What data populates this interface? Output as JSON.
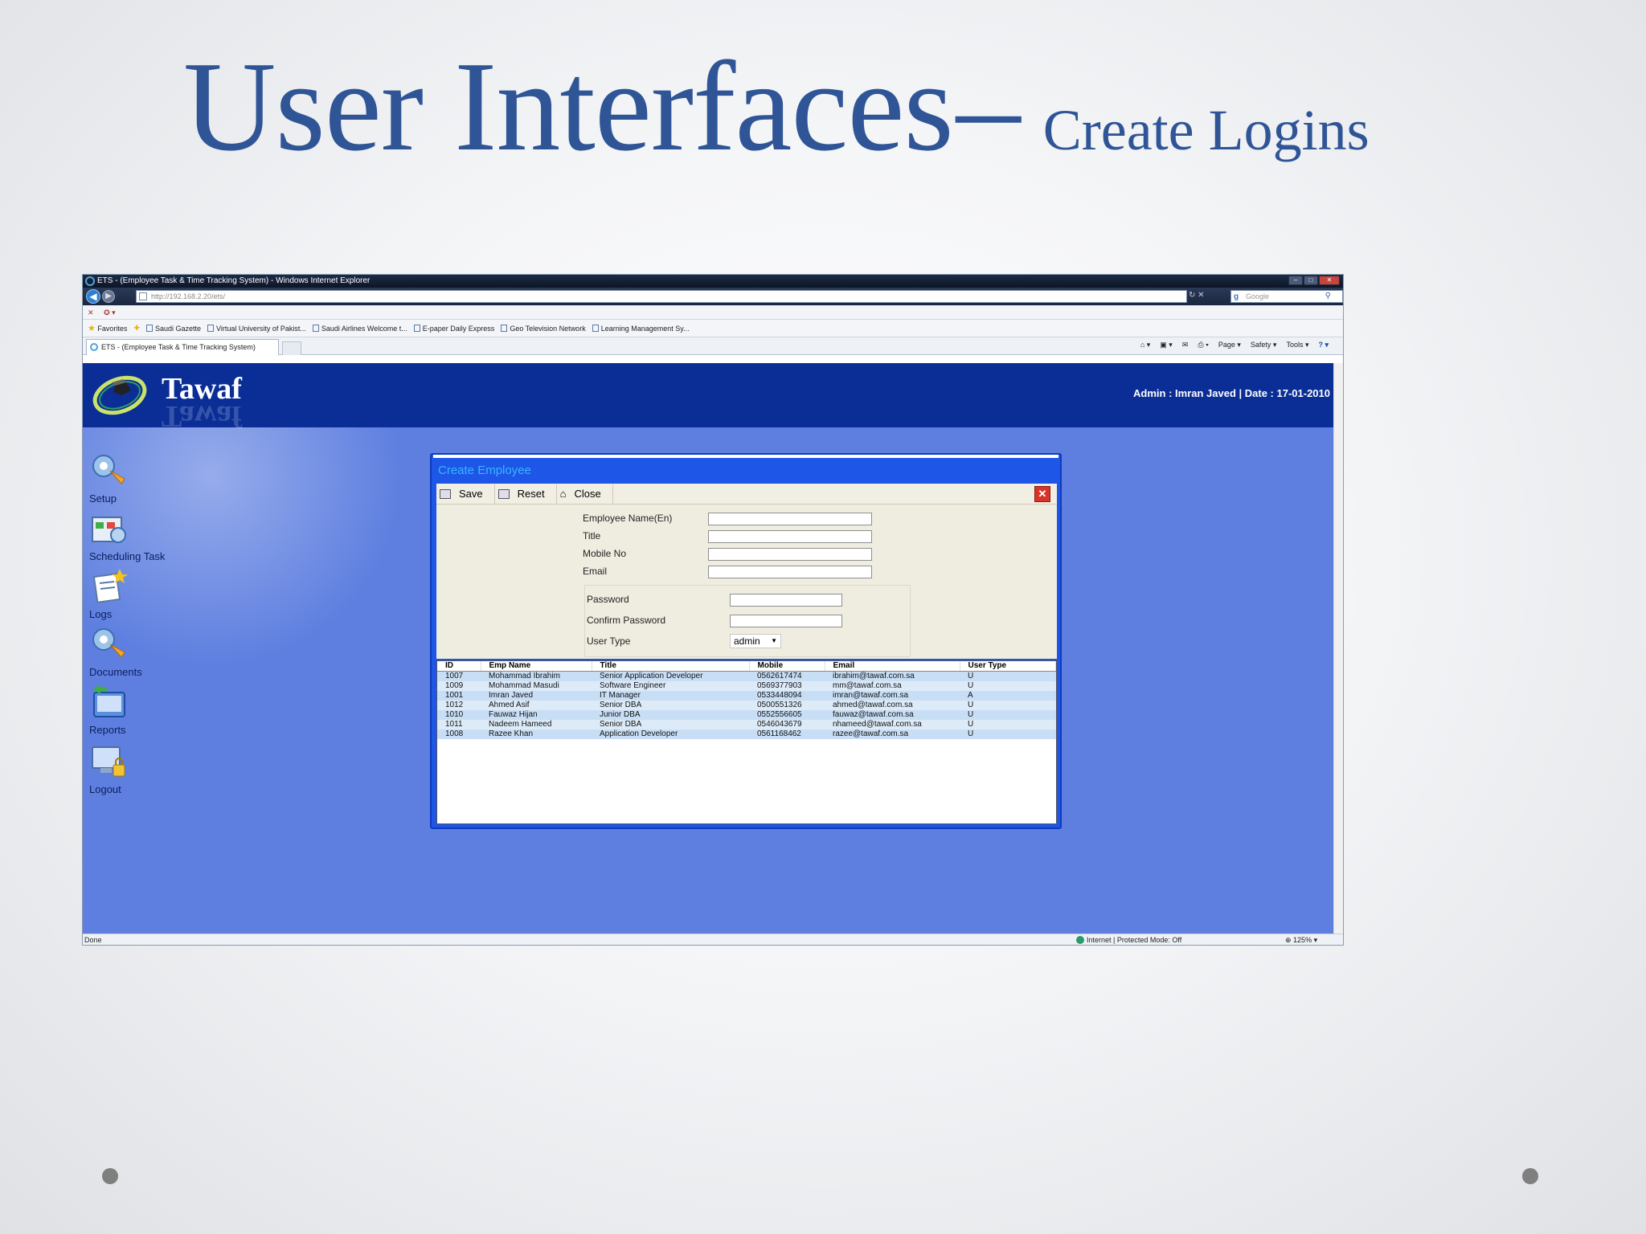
{
  "slide": {
    "title_main": "User Interfaces",
    "title_dash": "–",
    "title_sub": "Create Logins"
  },
  "browser": {
    "window_title": "ETS - (Employee Task & Time Tracking System) - Windows Internet Explorer",
    "url": "http://192.168.2.20/ets/",
    "search_placeholder": "Google",
    "favorites_label": "Favorites",
    "favorites": [
      "Saudi Gazette",
      "Virtual University of Pakist...",
      "Saudi Airlines  Welcome t...",
      "E-paper  Daily Express",
      "Geo Television Network",
      "Learning Management Sy..."
    ],
    "tab_title": "ETS - (Employee Task & Time Tracking System)",
    "toolbar": {
      "page": "Page ▾",
      "safety": "Safety ▾",
      "tools": "Tools ▾",
      "help": "? ▾"
    },
    "status_left": "Done",
    "status_zone": "Internet | Protected Mode: Off",
    "status_zoom": "125%"
  },
  "app": {
    "logo": "Tawaf",
    "header_info": "Admin : Imran Javed  |  Date : 17-01-2010",
    "sidebar": [
      {
        "label": "Setup",
        "icon": "setup-icon"
      },
      {
        "label": "Scheduling Task",
        "icon": "scheduling-icon"
      },
      {
        "label": "Logs",
        "icon": "logs-icon"
      },
      {
        "label": "Documents",
        "icon": "documents-icon"
      },
      {
        "label": "Reports",
        "icon": "reports-icon"
      },
      {
        "label": "Logout",
        "icon": "logout-icon"
      }
    ]
  },
  "dialog": {
    "title": "Create Employee",
    "toolbar": {
      "save": "Save",
      "reset": "Reset",
      "close": "Close"
    },
    "fields": {
      "name_label": "Employee Name(En)",
      "title_label": "Title",
      "mobile_label": "Mobile No",
      "email_label": "Email",
      "password_label": "Password",
      "confirm_label": "Confirm Password",
      "usertype_label": "User Type",
      "usertype_value": "admin"
    },
    "grid": {
      "columns": [
        "ID",
        "Emp Name",
        "Title",
        "Mobile",
        "Email",
        "User Type"
      ],
      "rows": [
        [
          "1007",
          "Mohammad Ibrahim",
          "Senior Application Developer",
          "0562617474",
          "ibrahim@tawaf.com.sa",
          "U"
        ],
        [
          "1009",
          "Mohammad Masudi",
          "Software Engineer",
          "0569377903",
          "mm@tawaf.com.sa",
          "U"
        ],
        [
          "1001",
          "Imran Javed",
          "IT Manager",
          "0533448094",
          "imran@tawaf.com.sa",
          "A"
        ],
        [
          "1012",
          "Ahmed Asif",
          "Senior DBA",
          "0500551326",
          "ahmed@tawaf.com.sa",
          "U"
        ],
        [
          "1010",
          "Fauwaz Hijan",
          "Junior DBA",
          "0552556605",
          "fauwaz@tawaf.com.sa",
          "U"
        ],
        [
          "1011",
          "Nadeem Hameed",
          "Senior DBA",
          "0546043679",
          "nhameed@tawaf.com.sa",
          "U"
        ],
        [
          "1008",
          "Razee Khan",
          "Application Developer",
          "0561168462",
          "razee@tawaf.com.sa",
          "U"
        ]
      ]
    }
  }
}
